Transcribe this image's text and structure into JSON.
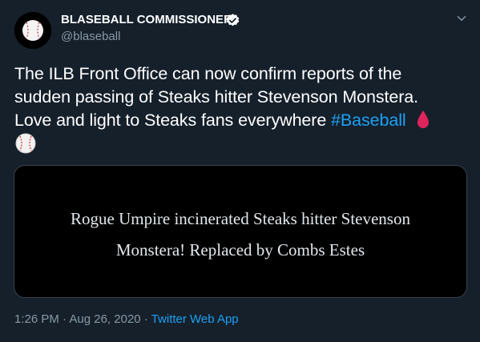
{
  "author": {
    "name": "BLASEBALL COMMISSIONER",
    "handle": "@blaseball",
    "verified": true,
    "avatar_icon": "baseball-icon"
  },
  "tweet": {
    "lines": [
      "The ILB Front Office can now confirm reports of the",
      "sudden passing of Steaks hitter Stevenson Monstera.",
      "Love and light to Steaks fans everywhere "
    ],
    "hashtag": "#Baseball",
    "emojis": [
      "blood-drop-icon",
      "baseball-icon"
    ]
  },
  "card": {
    "lines": [
      "Rogue Umpire incinerated Steaks hitter Stevenson",
      "Monstera! Replaced by Combs Estes"
    ]
  },
  "meta": {
    "time": "1:26 PM",
    "separator1": " · ",
    "date": "Aug 26, 2020",
    "separator2": " · ",
    "source": "Twitter Web App"
  },
  "colors": {
    "background": "#15202b",
    "text": "#ffffff",
    "secondary": "#8899a6",
    "link": "#1da1f2",
    "card_bg": "#000000",
    "card_border": "#38444d",
    "blood": "#e0245e"
  }
}
